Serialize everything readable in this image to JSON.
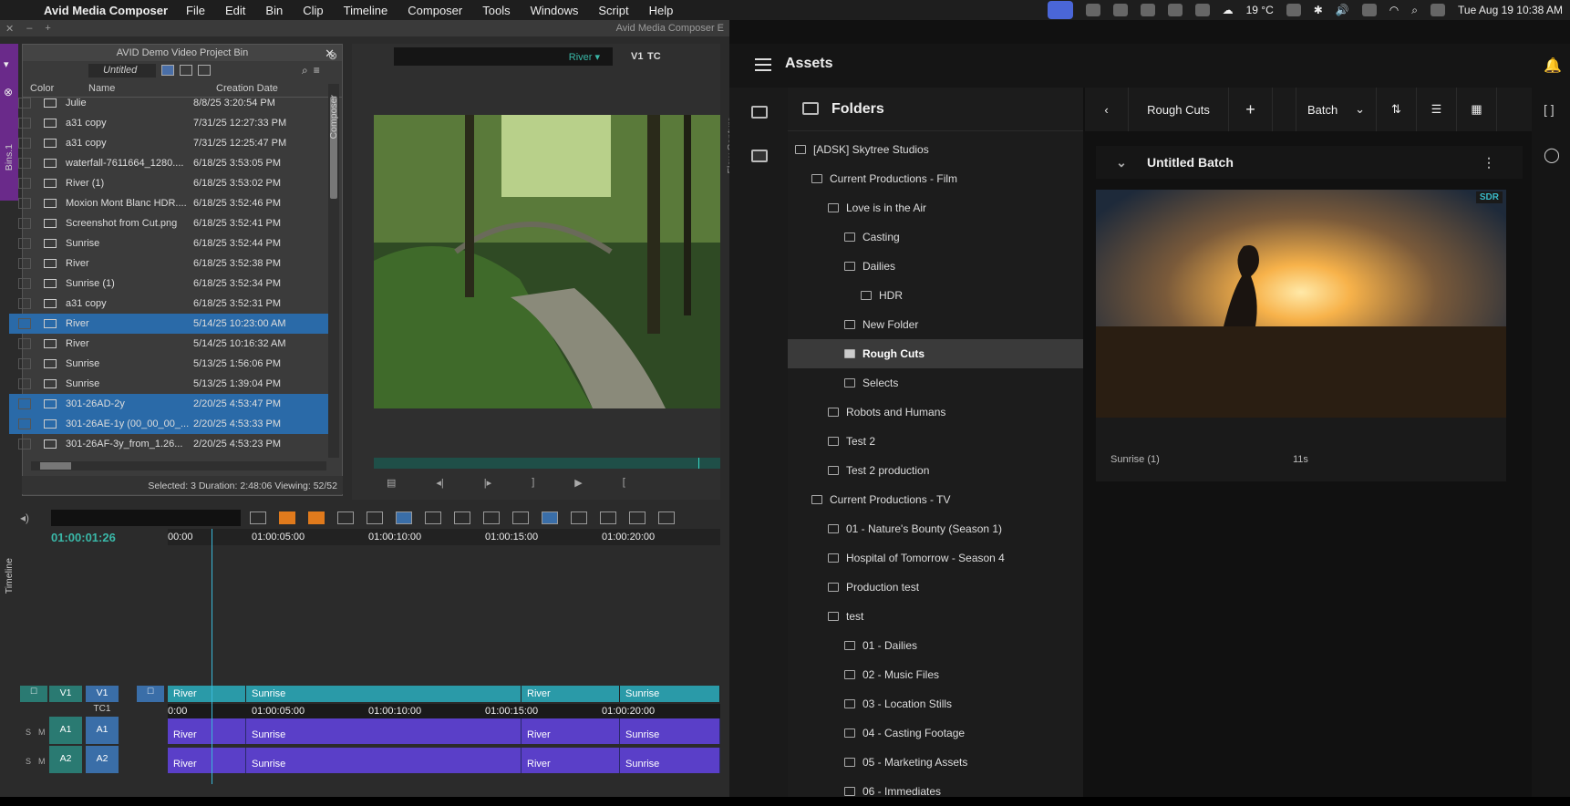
{
  "menubar": {
    "app": "Avid Media Composer",
    "menus": [
      "File",
      "Edit",
      "Bin",
      "Clip",
      "Timeline",
      "Composer",
      "Tools",
      "Windows",
      "Script",
      "Help"
    ],
    "weather": "19 °C",
    "datetime": "Tue Aug 19  10:38 AM"
  },
  "avid": {
    "window_title": "Avid Media Composer E",
    "bin": {
      "title": "AVID Demo Video Project Bin",
      "view": "Untitled",
      "col_color": "Color",
      "col_name": "Name",
      "col_date": "Creation Date",
      "rows": [
        {
          "name": "Julie",
          "date": "8/8/25 3:20:54 PM"
        },
        {
          "name": "a31 copy",
          "date": "7/31/25 12:27:33 PM"
        },
        {
          "name": "a31 copy",
          "date": "7/31/25 12:25:47 PM"
        },
        {
          "name": "waterfall-7611664_1280....",
          "date": "6/18/25 3:53:05 PM"
        },
        {
          "name": "River (1)",
          "date": "6/18/25 3:53:02 PM"
        },
        {
          "name": "Moxion Mont Blanc HDR....",
          "date": "6/18/25 3:52:46 PM"
        },
        {
          "name": "Screenshot from Cut.png",
          "date": "6/18/25 3:52:41 PM"
        },
        {
          "name": "Sunrise",
          "date": "6/18/25 3:52:44 PM"
        },
        {
          "name": "River",
          "date": "6/18/25 3:52:38 PM"
        },
        {
          "name": "Sunrise (1)",
          "date": "6/18/25 3:52:34 PM"
        },
        {
          "name": "a31 copy",
          "date": "6/18/25 3:52:31 PM"
        },
        {
          "name": "River",
          "date": "5/14/25 10:23:00 AM"
        },
        {
          "name": "River",
          "date": "5/14/25 10:16:32 AM"
        },
        {
          "name": "Sunrise",
          "date": "5/13/25 1:56:06 PM"
        },
        {
          "name": "Sunrise",
          "date": "5/13/25 1:39:04 PM"
        },
        {
          "name": "301-26AD-2y",
          "date": "2/20/25 4:53:47 PM"
        },
        {
          "name": "301-26AE-1y (00_00_00_...",
          "date": "2/20/25 4:53:33 PM"
        },
        {
          "name": "301-26AF-3y_from_1.26...",
          "date": "2/20/25 4:53:23 PM"
        }
      ],
      "status": "Selected: 3  Duration: 2:48:06  Viewing: 52/52",
      "side_tab": "Bins.1"
    },
    "composer": {
      "clip": "River",
      "track": "V1",
      "track2": "TC",
      "side_tab": "Composer"
    },
    "flow_capture_tab": "Flow Capture",
    "timeline": {
      "side_tab": "Timeline",
      "timecode": "01:00:01:26",
      "ruler": [
        "00:00",
        "01:00:05:00",
        "01:00:10:00",
        "01:00:15:00",
        "01:00:20:00"
      ],
      "tc_row": [
        "0:00",
        "01:00:05:00",
        "01:00:10:00",
        "01:00:15:00",
        "01:00:20:00"
      ],
      "v1": "V1",
      "v1b": "V1",
      "tc1": "TC1",
      "a1": "A1",
      "a1b": "A1",
      "a2": "A2",
      "a2b": "A2",
      "s": "S",
      "m": "M",
      "clips": [
        "River",
        "Sunrise",
        "River",
        "Sunrise"
      ]
    }
  },
  "assets": {
    "title": "Assets",
    "folders_title": "Folders",
    "tree": [
      {
        "label": "[ADSK] Skytree Studios",
        "level": 0
      },
      {
        "label": "Current Productions - Film",
        "level": 1
      },
      {
        "label": "Love is in the Air",
        "level": 2
      },
      {
        "label": "Casting",
        "level": 3
      },
      {
        "label": "Dailies",
        "level": 3
      },
      {
        "label": "HDR",
        "level": 4
      },
      {
        "label": "New Folder",
        "level": 3
      },
      {
        "label": "Rough Cuts",
        "level": 3,
        "selected": true
      },
      {
        "label": "Selects",
        "level": 3
      },
      {
        "label": "Robots and Humans",
        "level": 2
      },
      {
        "label": "Test 2",
        "level": 2
      },
      {
        "label": "Test 2 production",
        "level": 2
      },
      {
        "label": "Current Productions - TV",
        "level": 1
      },
      {
        "label": "01 - Nature's Bounty (Season 1)",
        "level": 2
      },
      {
        "label": "Hospital of Tomorrow - Season 4",
        "level": 2
      },
      {
        "label": "Production test",
        "level": 2
      },
      {
        "label": "test",
        "level": 2
      },
      {
        "label": "01 - Dailies",
        "level": 3
      },
      {
        "label": "02 - Music Files",
        "level": 3
      },
      {
        "label": "03 - Location Stills",
        "level": 3
      },
      {
        "label": "04 - Casting Footage",
        "level": 3
      },
      {
        "label": "05 - Marketing Assets",
        "level": 3
      },
      {
        "label": "06 - Immediates",
        "level": 3
      }
    ],
    "breadcrumb": "Rough Cuts",
    "batch_dropdown": "Batch",
    "batch_title": "Untitled Batch",
    "card": {
      "badge": "SDR",
      "name": "Sunrise (1)",
      "duration": "11s"
    }
  }
}
